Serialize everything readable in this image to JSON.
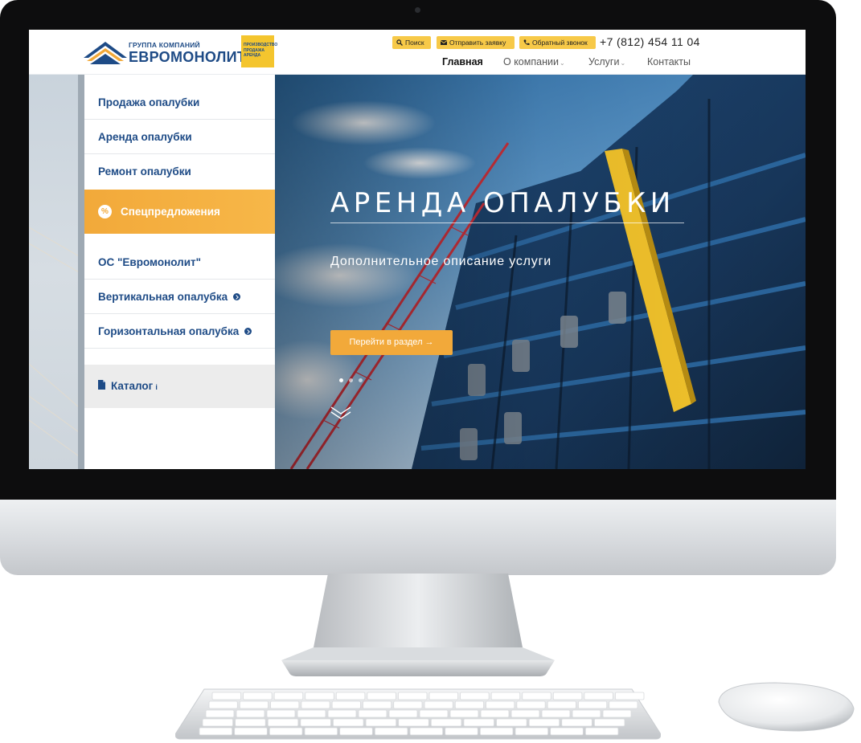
{
  "header": {
    "logo_group": "ГРУППА КОМПАНИЙ",
    "logo_name": "ЕВРОМОНОЛИТ",
    "logo_tag": [
      "ПРОИЗВОДСТВО",
      "ПРОДАЖА",
      "АРЕНДА"
    ],
    "buttons": [
      {
        "label": "Поиск",
        "icon": "search-icon"
      },
      {
        "label": "Отправить заявку",
        "icon": "envelope-icon"
      },
      {
        "label": "Обратный звонок",
        "icon": "phone-icon"
      }
    ],
    "phone": "+7 (812) 454 11 04",
    "nav": [
      {
        "label": "Главная",
        "active": true
      },
      {
        "label": "О компании",
        "dropdown": true
      },
      {
        "label": "Услуги",
        "dropdown": true
      },
      {
        "label": "Контакты"
      }
    ]
  },
  "sidebar": {
    "items": [
      {
        "label": "Продажа опалубки"
      },
      {
        "label": "Аренда опалубки"
      },
      {
        "label": "Ремонт опалубки"
      }
    ],
    "special": {
      "label": "Спецпредложения",
      "icon": "percent-icon"
    },
    "items2": [
      {
        "label": "ОС \"Евромонолит\""
      },
      {
        "label": "Вертикальная опалубка",
        "icon": "chevron-right-icon"
      },
      {
        "label": "Горизонтальная опалубка",
        "icon": "chevron-right-icon"
      }
    ],
    "catalog": {
      "label": "Каталог",
      "info": "i",
      "icon": "document-icon"
    }
  },
  "hero": {
    "title": "АРЕНДА ОПАЛУБКИ",
    "subtitle": "Дополнительное описание услуги",
    "button": "Перейти в раздел →",
    "slides": 3,
    "active_slide": 1
  },
  "colors": {
    "brand_blue": "#1e4b86",
    "accent_orange": "#f2a93a",
    "header_button_yellow": "#f7c948"
  }
}
